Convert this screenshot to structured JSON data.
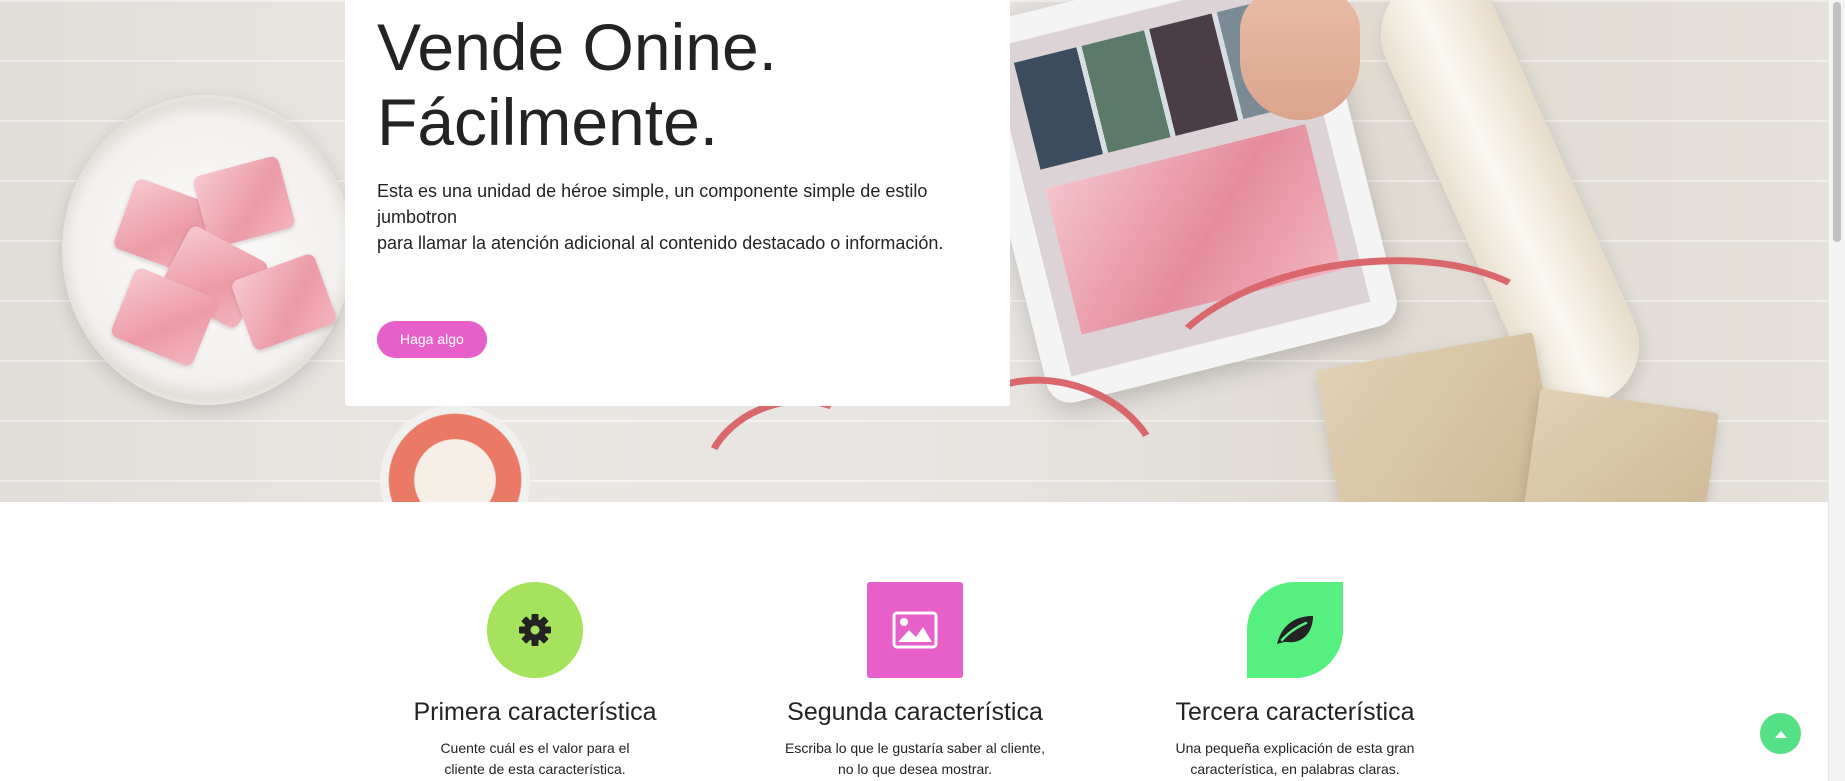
{
  "hero": {
    "title_line1": "Vende Onine.",
    "title_line2": "Fácilmente.",
    "text_line1": "Esta es una unidad de héroe simple, un componente simple de estilo jumbotron",
    "text_line2": "para llamar la atención adicional al contenido destacado o información.",
    "button_label": "Haga algo"
  },
  "features": [
    {
      "icon": "gear-icon",
      "color": "#a4e35b",
      "title": "Primera característica",
      "desc_line1": "Cuente cuál es el valor para el",
      "desc_line2": "cliente de esta característica."
    },
    {
      "icon": "image-icon",
      "color": "#e75fc9",
      "title": "Segunda característica",
      "desc_line1": "Escriba lo que le gustaría saber al cliente,",
      "desc_line2": "no lo que desea mostrar."
    },
    {
      "icon": "leaf-icon",
      "color": "#55f080",
      "title": "Tercera característica",
      "desc_line1": "Una pequeña explicación de esta gran",
      "desc_line2": "característica, en palabras claras."
    }
  ],
  "colors": {
    "accent": "#e75fc9",
    "back_to_top": "#54e083"
  }
}
